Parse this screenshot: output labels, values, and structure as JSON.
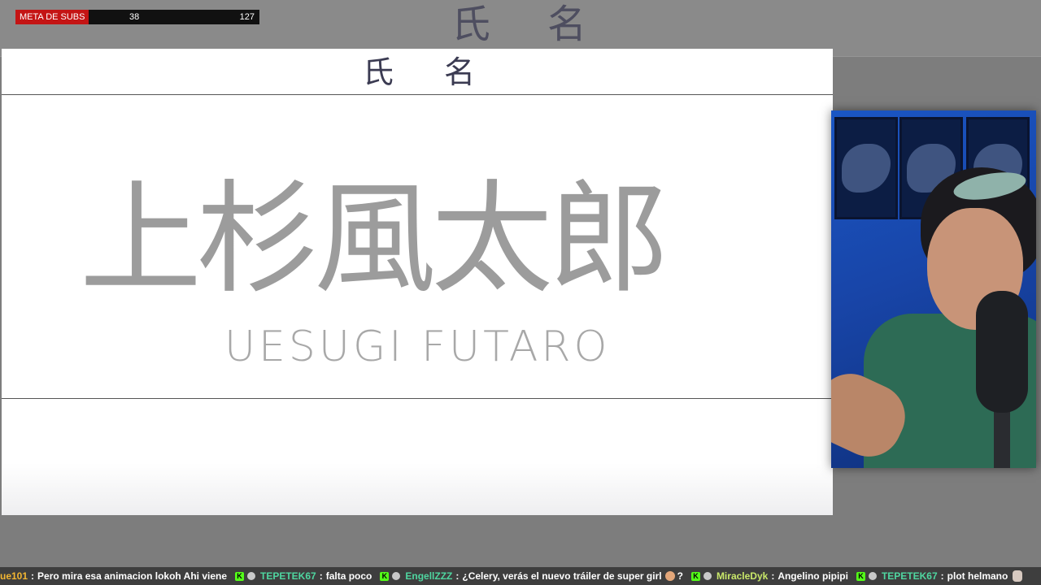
{
  "background": {
    "header_kanji": "氏名"
  },
  "subs_goal": {
    "label": "META DE SUBS",
    "current": "38",
    "target": "127",
    "progress_fraction": 0.3,
    "fill_color": "#c41414"
  },
  "video": {
    "header_kanji": "氏名",
    "name_kanji": "上杉風太郎",
    "name_romaji": "UESUGI FUTARO"
  },
  "webcam": {
    "label": ""
  },
  "chat": {
    "messages": [
      {
        "user": "ue101",
        "text": "Pero mira esa animacion lokoh  Ahi viene",
        "user_color": "#f2b632",
        "badges": []
      },
      {
        "user": "TEPETEK67",
        "text": "falta poco",
        "user_color": "#4fd6a0",
        "badges": [
          "kick-icon",
          "emote-icon"
        ]
      },
      {
        "user": "EngellZZZ",
        "text": "¿Celery, verás el nuevo tráiler de super girl",
        "user_color": "#4fd6a0",
        "badges": [
          "kick-icon",
          "emote-icon"
        ],
        "trailing": "?"
      },
      {
        "user": "MiracleDyk",
        "text": "Angelino pipipi",
        "user_color": "#c9e86a",
        "badges": [
          "kick-icon",
          "emote-icon"
        ]
      },
      {
        "user": "TEPETEK67",
        "text": "plot helmano",
        "user_color": "#4fd6a0",
        "badges": [
          "kick-icon",
          "emote-icon"
        ]
      }
    ],
    "separator": ":"
  }
}
